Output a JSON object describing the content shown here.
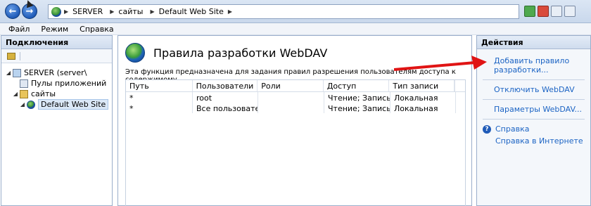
{
  "address": {
    "crumbs": [
      "SERVER",
      "сайты",
      "Default Web Site"
    ]
  },
  "menu": [
    "Файл",
    "Режим",
    "Справка"
  ],
  "connections": {
    "title": "Подключения",
    "tree": [
      {
        "label": "SERVER (server\\"
      },
      {
        "label": "Пулы приложений"
      },
      {
        "label": "сайты"
      },
      {
        "label": "Default Web Site"
      }
    ]
  },
  "main": {
    "title": "Правила разработки WebDAV",
    "description": "Эта функция предназначена для задания правил разрешения пользователям доступа к содержимому.",
    "columns": [
      "Путь",
      "Пользователи",
      "Роли",
      "Доступ",
      "Тип записи"
    ],
    "rows": [
      [
        "*",
        "root",
        "",
        "Чтение; Запись;",
        "Локальная"
      ],
      [
        "*",
        "Все пользователи",
        "",
        "Чтение; Запись;",
        "Локальная"
      ]
    ]
  },
  "actions": {
    "title": "Действия",
    "add_rule_line1": "Добавить правило",
    "add_rule_line2": "разработки...",
    "disable": "Отключить WebDAV",
    "settings": "Параметры WebDAV...",
    "help": "Справка",
    "online_help": "Справка в Интернете"
  },
  "colors": {
    "link": "#1c64c4",
    "arrow": "#e01414"
  }
}
